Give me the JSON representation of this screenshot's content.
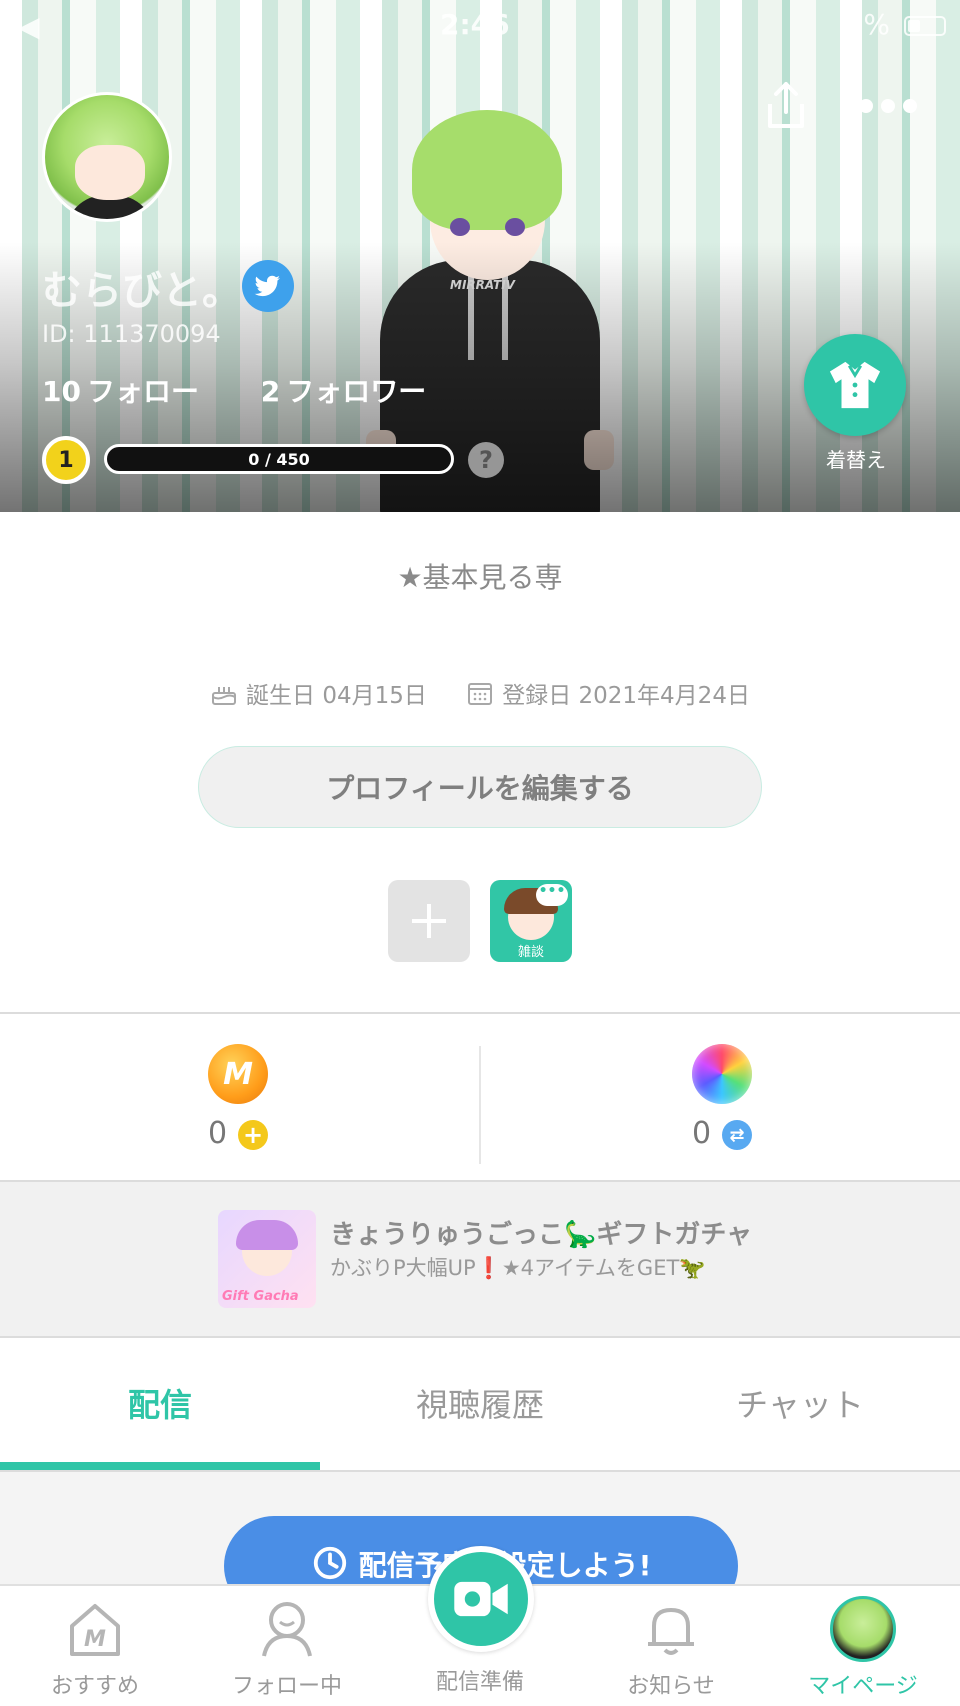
{
  "status_bar": {
    "back": "◀",
    "time": "2:46",
    "battery": "%"
  },
  "profile": {
    "name": "むらびと。",
    "id_text": "ID: 111370094",
    "follow_count": "10",
    "follow_label": "フォロー",
    "follower_count": "2",
    "follower_label": "フォロワー",
    "level": "1",
    "exp_text": "0 / 450",
    "exp_progress": 0,
    "help": "?",
    "dress_label": "着替え",
    "bio": "★基本見る専",
    "birthday": "誕生日 04月15日",
    "registered": "登録日 2021年4月24日",
    "edit_button": "プロフィールを編集する",
    "tag_label": "雑談"
  },
  "wallet": {
    "coins": "0",
    "orbs": "0"
  },
  "banner": {
    "title": "きょうりゅうごっこ🦕ギフトガチャ",
    "subtitle": "かぶりP大幅UP❗★4アイテムをGET🦖",
    "image_text": "Gift Gacha"
  },
  "tabs": [
    {
      "label": "配信",
      "active": true
    },
    {
      "label": "視聴履歴",
      "active": false
    },
    {
      "label": "チャット",
      "active": false
    }
  ],
  "schedule_button": "配信予定を設定しよう!",
  "bottom_nav": {
    "recommend": "おすすめ",
    "following": "フォロー中",
    "broadcast": "配信準備",
    "notifications": "お知らせ",
    "mypage": "マイページ"
  },
  "colors": {
    "accent": "#2fc5a7",
    "blue_button": "#4a8ee6",
    "twitter": "#3ea1ec",
    "level_yellow": "#f2d21b"
  }
}
